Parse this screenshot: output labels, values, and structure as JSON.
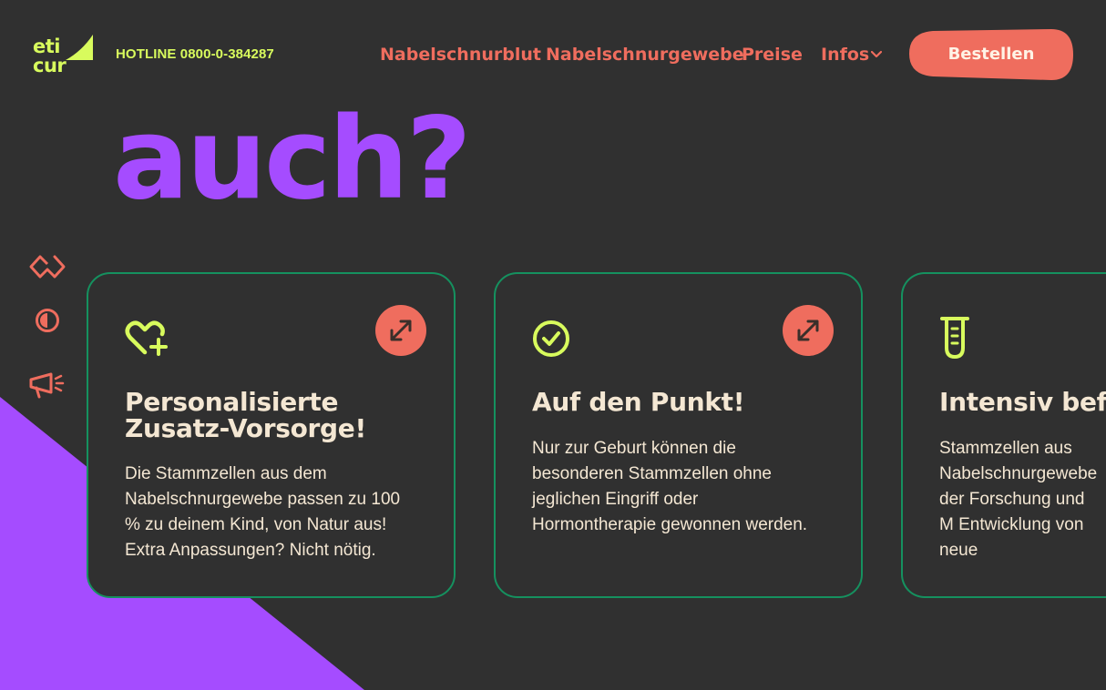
{
  "brand": {
    "logo_line1": "eti",
    "logo_line2": "cur",
    "hotline": "HOTLINE 0800-0-384287"
  },
  "nav": {
    "items": [
      {
        "label": "Nabelschnurblut"
      },
      {
        "label": "Nabelschnurgewebe"
      },
      {
        "label": "Preise"
      },
      {
        "label": "Infos"
      }
    ],
    "order_button": "Bestellen"
  },
  "hero": {
    "headline": "auch?"
  },
  "side_icons": [
    "hands-heart-icon",
    "contrast-icon",
    "megaphone-icon"
  ],
  "cards": [
    {
      "icon": "heart-plus-icon",
      "title": "Personalisierte Zusatz-Vorsorge!",
      "text": "Die Stammzellen aus dem Nabelschnurgewebe passen zu 100 % zu deinem Kind, von Natur aus! Extra Anpassungen? Nicht nötig."
    },
    {
      "icon": "check-circle-icon",
      "title": "Auf den Punkt!",
      "text": "Nur zur Geburt können die besonderen Stammzellen ohne jeglichen Eingriff oder Hormontherapie gewonnen werden."
    },
    {
      "icon": "test-tube-icon",
      "title": "Intensiv befo",
      "text": "Stammzellen aus Nabelschnurgewebe der Forschung und M Entwicklung von neue"
    }
  ],
  "colors": {
    "background": "#303030",
    "accent_coral": "#ef6d5e",
    "accent_lime": "#d8fb5d",
    "accent_purple": "#a54cff",
    "card_border": "#15915f"
  }
}
